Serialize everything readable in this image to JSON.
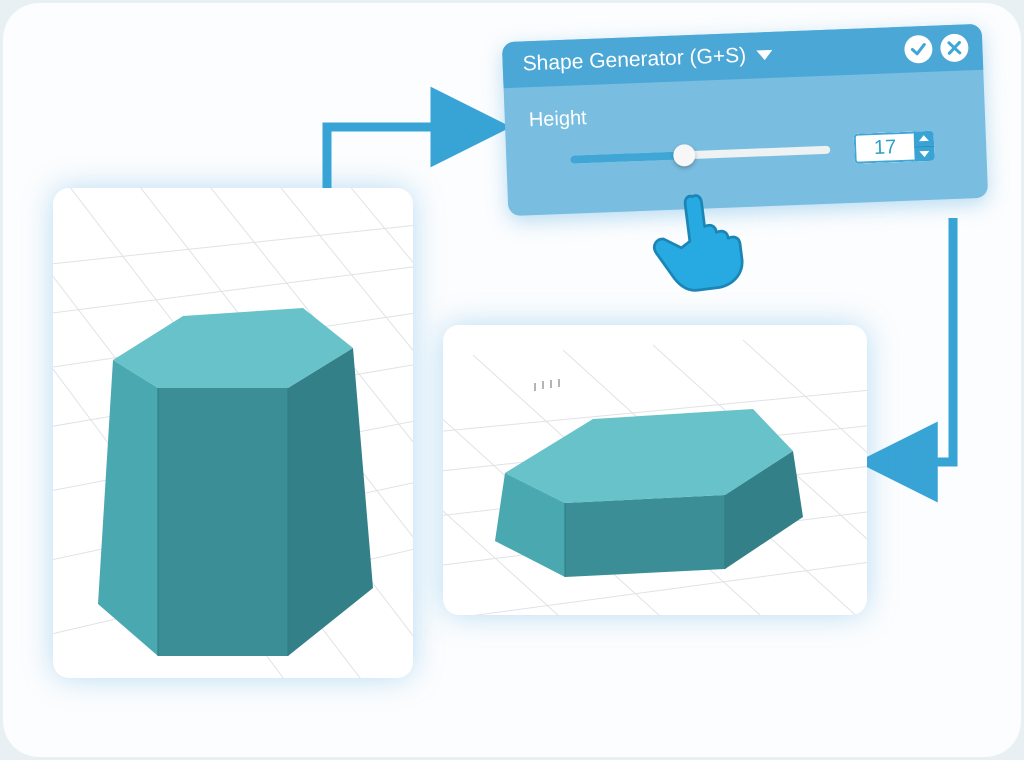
{
  "panel": {
    "title": "Shape Generator (G+S)",
    "param_label": "Height",
    "param_value": "17"
  },
  "icons": {
    "caret": "chevron-down",
    "confirm": "check",
    "close": "x",
    "cursor": "pointing-hand"
  },
  "colors": {
    "panel_header": "#4ba7d6",
    "panel_body": "#79bde0",
    "accent": "#27aae1",
    "prism_top": "#6cc6cd",
    "prism_side_light": "#4aa5ae",
    "prism_side_dark": "#3a8d96"
  },
  "flow": {
    "step1": "tall-hexagonal-prism",
    "step2": "shape-generator-panel",
    "step3": "short-hexagonal-prism"
  }
}
